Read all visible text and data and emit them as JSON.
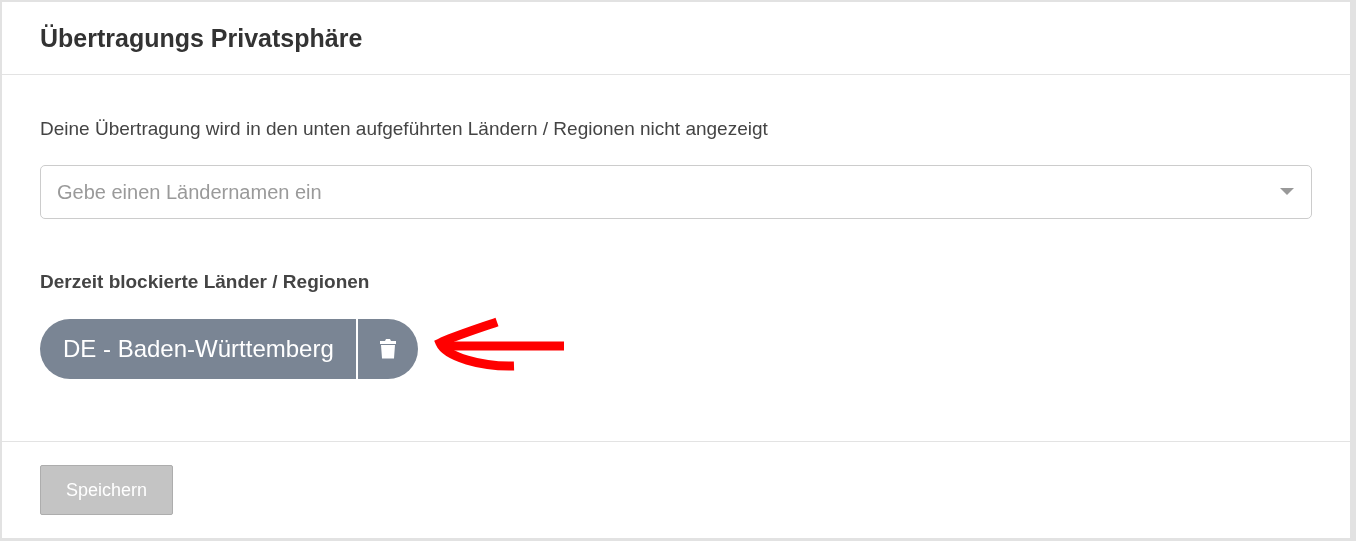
{
  "panel": {
    "title": "Übertragungs Privatsphäre"
  },
  "description": "Deine Übertragung wird in den unten aufgeführten Ländern / Regionen nicht angezeigt",
  "country_select": {
    "placeholder": "Gebe einen Ländernamen ein"
  },
  "blocked_heading": "Derzeit blockierte Länder / Regionen",
  "blocked_regions": [
    {
      "label": "DE - Baden-Württemberg"
    }
  ],
  "save_button": {
    "label": "Speichern",
    "disabled": true
  }
}
